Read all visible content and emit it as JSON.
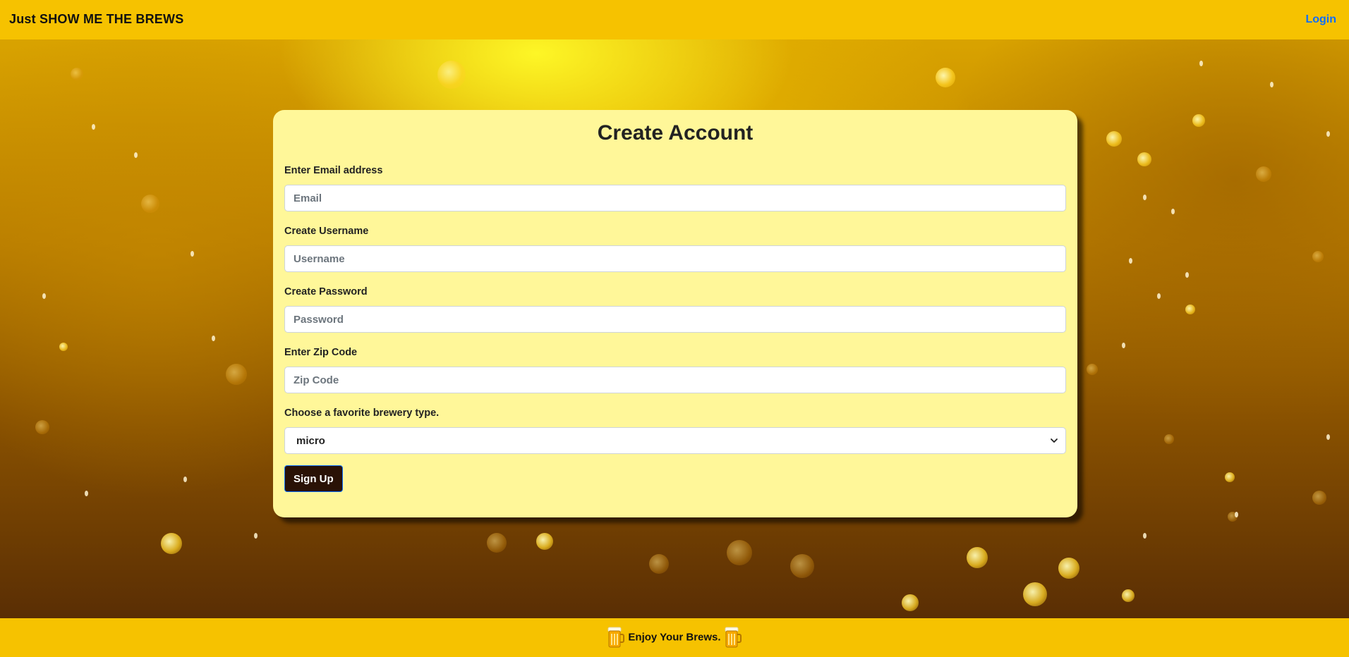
{
  "navbar": {
    "brand": "Just SHOW ME THE BREWS",
    "login_label": "Login"
  },
  "form": {
    "title": "Create Account",
    "email": {
      "label": "Enter Email address",
      "placeholder": "Email",
      "value": ""
    },
    "username": {
      "label": "Create Username",
      "placeholder": "Username",
      "value": ""
    },
    "password": {
      "label": "Create Password",
      "placeholder": "Password",
      "value": ""
    },
    "zip": {
      "label": "Enter Zip Code",
      "placeholder": "Zip Code",
      "value": ""
    },
    "brewery_type": {
      "label": "Choose a favorite brewery type.",
      "selected": "micro"
    },
    "submit_label": "Sign Up"
  },
  "footer": {
    "text": "Enjoy Your Brews.",
    "icons": [
      "beer-mug-icon",
      "beer-mug-icon"
    ]
  },
  "colors": {
    "bar": "#f6c200",
    "card": "#fff799",
    "button": "#2a1206",
    "link": "#0d6efd"
  }
}
